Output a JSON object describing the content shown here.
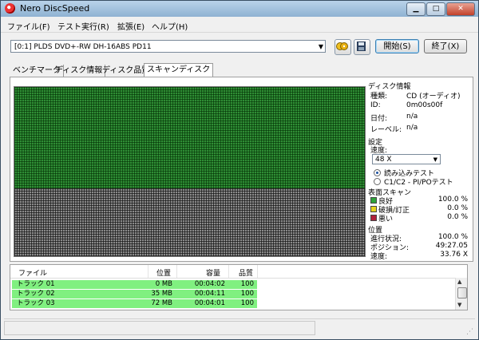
{
  "window": {
    "title": "Nero DiscSpeed"
  },
  "menu": [
    "ファイル(F)",
    "テスト実行(R)",
    "拡張(E)",
    "ヘルプ(H)"
  ],
  "toolbar": {
    "drive": "[0:1]  PLDS DVD+-RW DH-16ABS PD11",
    "start_label": "開始(S)",
    "exit_label": "終了(X)"
  },
  "tabs": [
    "ベンチマーク",
    "ディスク情報",
    "ディスク品質",
    "スキャンディスク"
  ],
  "active_tab": 3,
  "scan": {
    "good_fraction": 0.6,
    "colors": {
      "good": "#2f8d35",
      "unscanned": "#8a8a8a"
    }
  },
  "disc_info": {
    "heading": "ディスク情報",
    "type_label": "種類:",
    "type_value": "CD (オーディオ)",
    "id_label": "ID:",
    "id_value": "0m00s00f",
    "date_label": "日付:",
    "date_value": "n/a",
    "label_label": "レーベル:",
    "label_value": "n/a"
  },
  "settings": {
    "heading": "設定",
    "speed_label": "速度:",
    "speed_value": "48 X",
    "radio_read": "読み込みテスト",
    "radio_c1c2": "C1/C2 - PI/POテスト"
  },
  "surface_scan": {
    "heading": "表面スキャン",
    "good_label": "良好",
    "good_value": "100.0 %",
    "damaged_label": "破損/訂正",
    "damaged_value": "0.0 %",
    "bad_label": "悪い",
    "bad_value": "0.0 %",
    "colors": {
      "good": "#2fa33a",
      "damaged": "#e6d21e",
      "bad": "#b0203a"
    }
  },
  "position": {
    "heading": "位置",
    "progress_label": "進行状況:",
    "progress_value": "100.0 %",
    "position_label": "ポジション:",
    "position_value": "49:27.05",
    "speed_label": "速度:",
    "speed_value": "33.76 X"
  },
  "track_table": {
    "headers": [
      "ファイル",
      "位置",
      "容量",
      "品質"
    ],
    "rows": [
      {
        "file": "トラック 01",
        "position": "0 MB",
        "size": "00:04:02",
        "quality": "100"
      },
      {
        "file": "トラック 02",
        "position": "35 MB",
        "size": "00:04:11",
        "quality": "100"
      },
      {
        "file": "トラック 03",
        "position": "72 MB",
        "size": "00:04:01",
        "quality": "100"
      }
    ]
  }
}
